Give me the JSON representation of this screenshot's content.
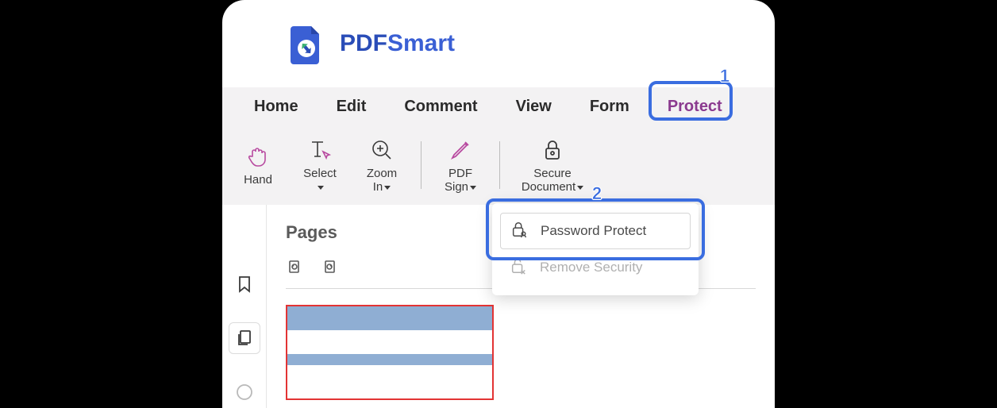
{
  "brand": {
    "pdf": "PDF",
    "smart": "Smart"
  },
  "menu": {
    "home": "Home",
    "edit": "Edit",
    "comment": "Comment",
    "view": "View",
    "form": "Form",
    "protect": "Protect"
  },
  "ribbon": {
    "hand": "Hand",
    "select_line1": "Select",
    "zoom_line1": "Zoom",
    "zoom_line2": "In",
    "pdf_line1": "PDF",
    "pdf_line2": "Sign",
    "secure_line1": "Secure",
    "secure_line2": "Document"
  },
  "sidebar": {
    "pages_title": "Pages"
  },
  "dropdown": {
    "password_protect": "Password Protect",
    "remove_security": "Remove Security"
  },
  "callouts": {
    "one": "1",
    "two": "2"
  }
}
